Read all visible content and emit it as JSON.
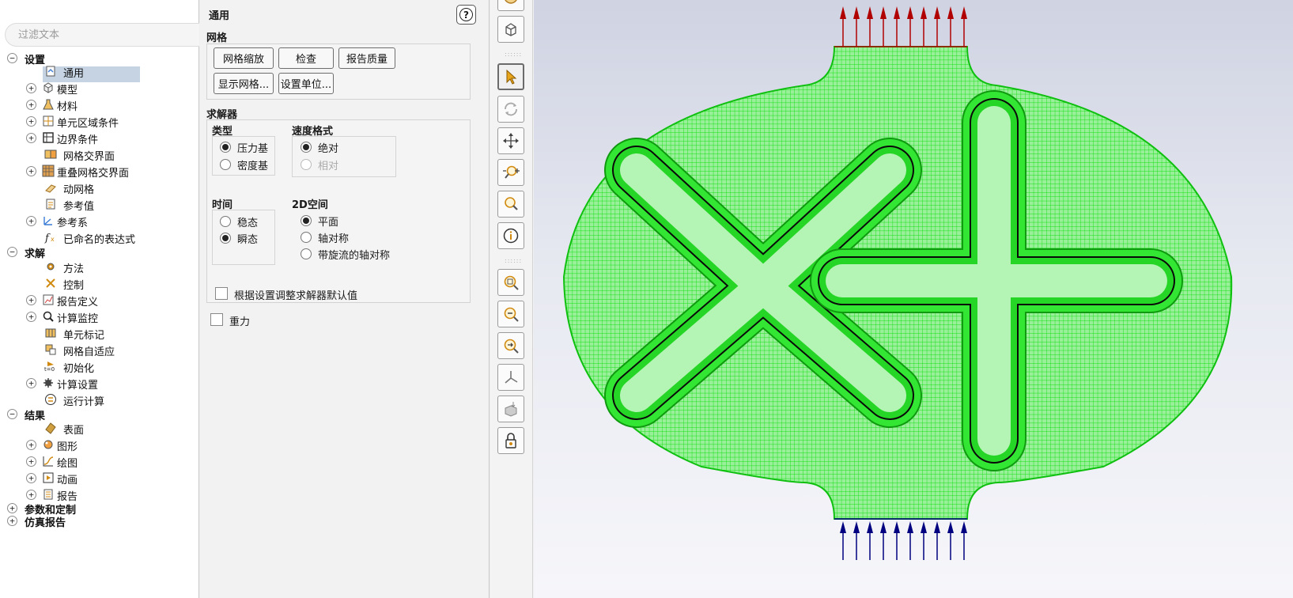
{
  "tree": {
    "filter_placeholder": "过滤文本",
    "nodes": [
      {
        "label": "设置"
      },
      {
        "label": "通用"
      },
      {
        "label": "模型"
      },
      {
        "label": "材料"
      },
      {
        "label": "单元区域条件"
      },
      {
        "label": "边界条件"
      },
      {
        "label": "网格交界面"
      },
      {
        "label": "重叠网格交界面"
      },
      {
        "label": "动网格"
      },
      {
        "label": "参考值"
      },
      {
        "label": "参考系"
      },
      {
        "label": "已命名的表达式"
      },
      {
        "label": "求解"
      },
      {
        "label": "方法"
      },
      {
        "label": "控制"
      },
      {
        "label": "报告定义"
      },
      {
        "label": "计算监控"
      },
      {
        "label": "单元标记"
      },
      {
        "label": "网格自适应"
      },
      {
        "label": "初始化"
      },
      {
        "label": "计算设置"
      },
      {
        "label": "运行计算"
      },
      {
        "label": "结果"
      },
      {
        "label": "表面"
      },
      {
        "label": "图形"
      },
      {
        "label": "绘图"
      },
      {
        "label": "动画"
      },
      {
        "label": "报告"
      },
      {
        "label": "参数和定制"
      },
      {
        "label": "仿真报告"
      }
    ],
    "init_icon_text": "t=0"
  },
  "settings": {
    "title": "通用",
    "help": "?",
    "mesh": {
      "label": "网格",
      "buttons": [
        "网格缩放",
        "检查",
        "报告质量",
        "显示网格...",
        "设置单位..."
      ]
    },
    "solver": {
      "label": "求解器",
      "type": {
        "label": "类型",
        "options": [
          "压力基",
          "密度基"
        ],
        "selected": 0
      },
      "velocity": {
        "label": "速度格式",
        "options": [
          "绝对",
          "相对"
        ],
        "selected": 0
      },
      "time": {
        "label": "时间",
        "options": [
          "稳态",
          "瞬态"
        ],
        "selected": 1
      },
      "space2d": {
        "label": "2D空间",
        "options": [
          "平面",
          "轴对称",
          "带旋流的轴对称"
        ],
        "selected": 0
      },
      "adjust_defaults": "根据设置调整求解器默认值"
    },
    "gravity": "重力"
  },
  "toolbar": {
    "tools": [
      "fit-view-icon",
      "isometric-icon",
      "pointer-icon",
      "rotate-icon",
      "pan-icon",
      "zoom-icon",
      "probe-icon",
      "info-icon",
      "zoom-box-icon",
      "zoom-out-icon",
      "zoom-in-icon",
      "axes-icon",
      "view-cube-icon",
      "lock-icon"
    ]
  },
  "colors": {
    "mesh": "#00e000",
    "outflow_arrows": "#b00000",
    "inflow_arrows": "#000080",
    "selection": "#c5d3e3"
  }
}
